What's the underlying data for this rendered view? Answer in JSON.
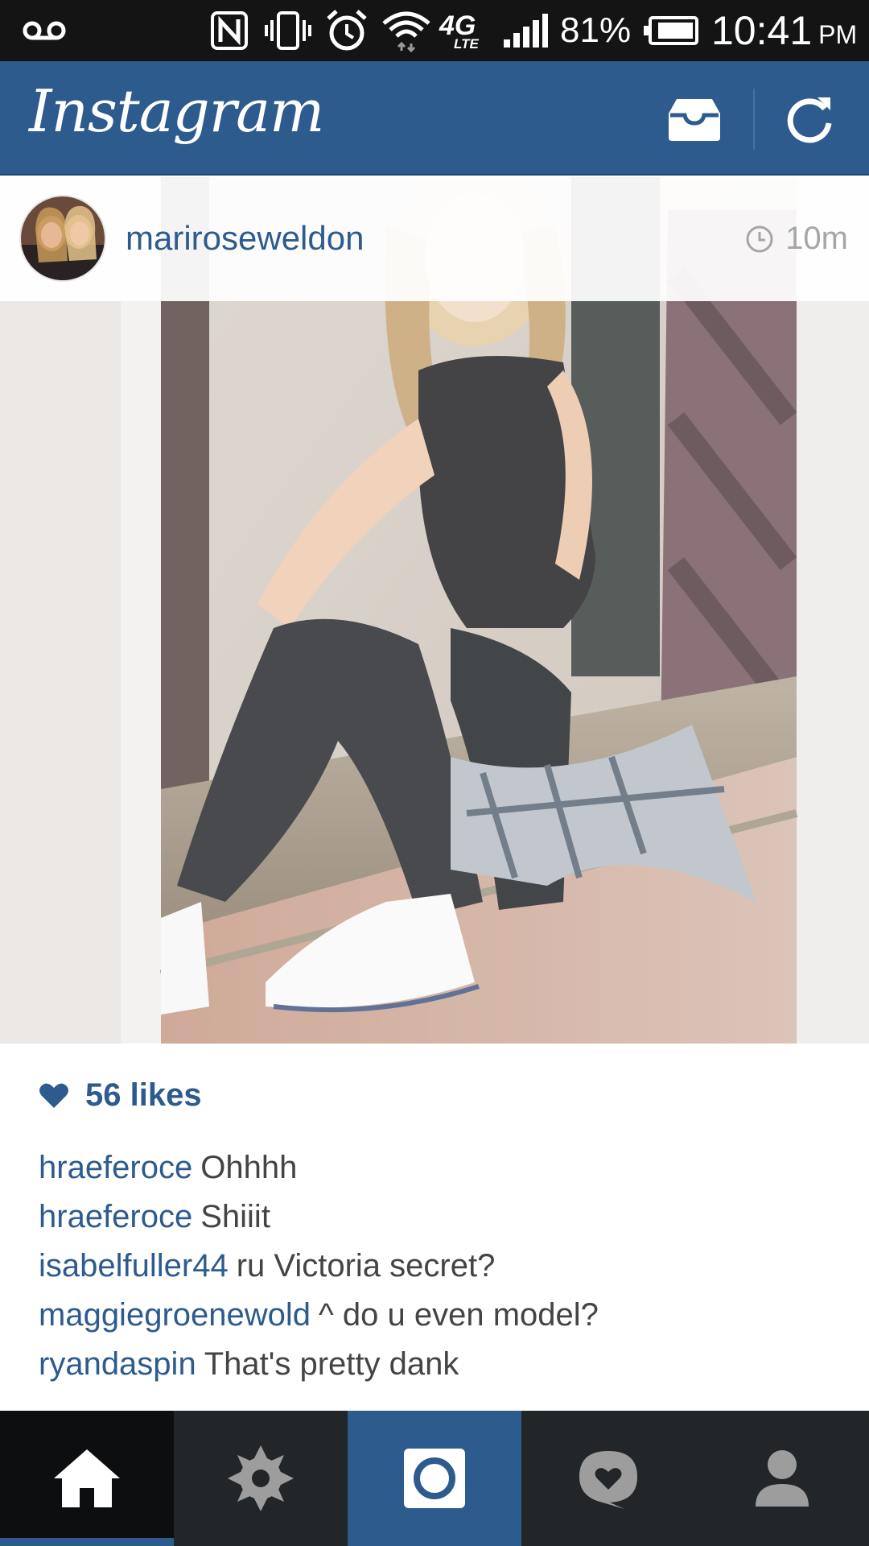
{
  "status_bar": {
    "battery_percent": "81%",
    "time": "10:41",
    "ampm": "PM",
    "network_label": "4G",
    "network_sub": "LTE"
  },
  "app_bar": {
    "title": "Instagram",
    "accent_color": "#2d5b8d",
    "icons": [
      "inbox-icon",
      "refresh-icon"
    ]
  },
  "post": {
    "username": "mariroseweldon",
    "time": "10m",
    "likes": "56 likes",
    "comments": [
      {
        "user": "hraeferoce",
        "text": "Ohhhh"
      },
      {
        "user": "hraeferoce",
        "text": "Shiiit"
      },
      {
        "user": "isabelfuller44",
        "text": "ru Victoria secret?"
      },
      {
        "user": "maggiegroenewold",
        "text": "^ do u even model?"
      },
      {
        "user": "ryandaspin",
        "text": "That's pretty dank"
      }
    ]
  },
  "bottom_nav": {
    "items": [
      "home-icon",
      "explore-icon",
      "camera-icon",
      "activity-icon",
      "profile-icon"
    ],
    "active": "home-icon"
  }
}
